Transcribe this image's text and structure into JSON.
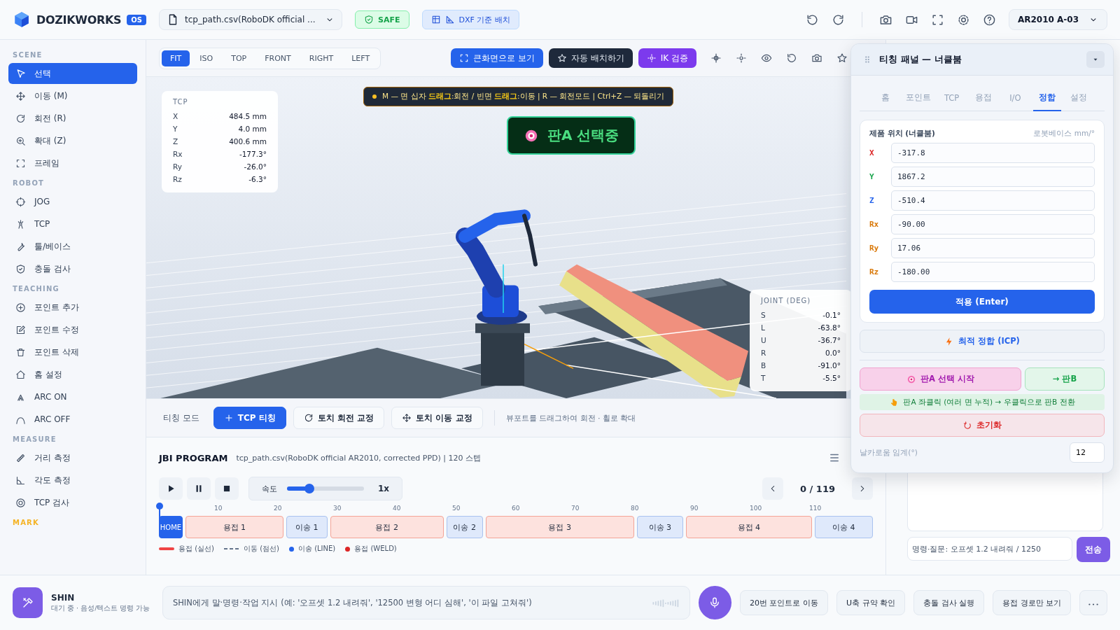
{
  "topbar": {
    "brand": "DOZIKWORKS",
    "badge": "OS",
    "file": "tcp_path.csv(RoboDK official ...",
    "safety": "SAFE",
    "layout_button": "DXF 기준 배치",
    "robot": "AR2010 A-03"
  },
  "sidebar": {
    "sections": [
      {
        "title": "SCENE",
        "color": "#94a3b8",
        "items": [
          {
            "label": "선택",
            "selected": true
          },
          {
            "label": "이동 (M)",
            "selected": false
          },
          {
            "label": "회전 (R)",
            "selected": false
          },
          {
            "label": "확대 (Z)",
            "selected": false
          },
          {
            "label": "프레임",
            "selected": false
          }
        ]
      },
      {
        "title": "ROBOT",
        "color": "#94a3b8",
        "items": [
          {
            "label": "JOG",
            "selected": false
          },
          {
            "label": "TCP",
            "selected": false
          },
          {
            "label": "툴/베이스",
            "selected": false
          },
          {
            "label": "충돌 검사",
            "selected": false
          }
        ]
      },
      {
        "title": "TEACHING",
        "color": "#94a3b8",
        "items": [
          {
            "label": "포인트 추가",
            "selected": false
          },
          {
            "label": "포인트 수정",
            "selected": false
          },
          {
            "label": "포인트 삭제",
            "selected": false
          },
          {
            "label": "홈 설정",
            "selected": false
          },
          {
            "label": "ARC ON",
            "selected": false
          },
          {
            "label": "ARC OFF",
            "selected": false
          }
        ]
      },
      {
        "title": "MEASURE",
        "color": "#94a3b8",
        "items": [
          {
            "label": "거리 측정",
            "selected": false
          },
          {
            "label": "각도 측정",
            "selected": false
          },
          {
            "label": "TCP 검사",
            "selected": false
          }
        ]
      },
      {
        "title": "MARK",
        "color": "#f5b324"
      }
    ]
  },
  "viewport": {
    "views": [
      {
        "label": "FIT",
        "selected": true
      },
      {
        "label": "ISO",
        "selected": false
      },
      {
        "label": "TOP",
        "selected": false
      },
      {
        "label": "FRONT",
        "selected": false
      },
      {
        "label": "RIGHT",
        "selected": false
      },
      {
        "label": "LEFT",
        "selected": false
      }
    ],
    "actions": [
      {
        "label": "큰화면으로 보기",
        "kind": "primary"
      },
      {
        "label": "자동 배치하기",
        "kind": "dark"
      },
      {
        "label": "IK 검증",
        "kind": "accent"
      }
    ],
    "hint": "M — 면 십자 **드래그**:회전 / 빈면 **드래그**:이동 | R — 회전모드 | Ctrl+Z — 되돌리기",
    "toast": "판A 선택중",
    "tcp": {
      "title": "TCP",
      "rows": [
        {
          "axis": "X",
          "value": "484.5 mm"
        },
        {
          "axis": "Y",
          "value": "4.0 mm"
        },
        {
          "axis": "Z",
          "value": "400.6 mm"
        },
        {
          "axis": "Rx",
          "value": "-177.3°"
        },
        {
          "axis": "Ry",
          "value": "-26.0°"
        },
        {
          "axis": "Rz",
          "value": "-6.3°"
        }
      ]
    },
    "joints": {
      "title": "JOINT (DEG)",
      "rows": [
        {
          "axis": "S",
          "value": "-0.1°"
        },
        {
          "axis": "L",
          "value": "-63.8°"
        },
        {
          "axis": "U",
          "value": "-36.7°"
        },
        {
          "axis": "R",
          "value": "0.0°"
        },
        {
          "axis": "B",
          "value": "-91.0°"
        },
        {
          "axis": "T",
          "value": "-5.5°"
        }
      ]
    }
  },
  "teach_bar": {
    "label": "티칭 모드",
    "modes": [
      {
        "label": "TCP 티칭",
        "selected": true
      },
      {
        "label": "토치 회전 교정",
        "selected": false
      },
      {
        "label": "토치 이동 교정",
        "selected": false
      }
    ],
    "hint": "뷰포트를 드래그하여 회전 · 휠로 확대"
  },
  "program": {
    "title": "JBI PROGRAM",
    "subtitle": "tcp_path.csv(RoboDK official AR2010, corrected PPD) | 120 스텝",
    "speed_label": "속도",
    "speed": {
      "level": 0.25
    },
    "speed_reading": "1x",
    "position": "0 / 119",
    "ticks": [
      "10",
      "20",
      "30",
      "40",
      "50",
      "60",
      "70",
      "80",
      "90",
      "100",
      "110"
    ],
    "segments": [
      {
        "label": "HOME",
        "kind": "home"
      },
      {
        "label": "용접 1",
        "kind": "weld"
      },
      {
        "label": "이송 1",
        "kind": "move"
      },
      {
        "label": "용접 2",
        "kind": "weld"
      },
      {
        "label": "이송 2",
        "kind": "move"
      },
      {
        "label": "용접 3",
        "kind": "weld"
      },
      {
        "label": "이송 3",
        "kind": "move"
      },
      {
        "label": "용접 4",
        "kind": "weld"
      },
      {
        "label": "이송 4",
        "kind": "move"
      }
    ],
    "legend": [
      {
        "label": "용접 (실선)",
        "kind": "line",
        "color": "#ef4444"
      },
      {
        "label": "이동 (점선)",
        "kind": "dashed",
        "color": "#64748b"
      },
      {
        "label": "이송 (LINE)",
        "kind": "dot",
        "color": "#2563eb"
      },
      {
        "label": "용접 (WELD)",
        "kind": "dot",
        "color": "#dc2626"
      }
    ]
  },
  "panel": {
    "title": "티칭 패널 — 너클붐",
    "tabs": [
      {
        "label": "홈",
        "selected": false
      },
      {
        "label": "포인트",
        "selected": false
      },
      {
        "label": "TCP",
        "selected": false
      },
      {
        "label": "용접",
        "selected": false
      },
      {
        "label": "I/O",
        "selected": false
      },
      {
        "label": "정합",
        "selected": true
      },
      {
        "label": "설정",
        "selected": false
      }
    ],
    "card_title": "제품 위치 (너클붐)",
    "card_unit": "로봇베이스 mm/°",
    "fields": [
      {
        "label": "X",
        "value": "-317.8",
        "color": "#dc2626"
      },
      {
        "label": "Y",
        "value": "1867.2",
        "color": "#16a34a"
      },
      {
        "label": "Z",
        "value": "-510.4",
        "color": "#2563eb"
      },
      {
        "label": "Rx",
        "value": "-90.00",
        "color": "#d97706"
      },
      {
        "label": "Ry",
        "value": "17.06",
        "color": "#d97706"
      },
      {
        "label": "Rz",
        "value": "-180.00",
        "color": "#d97706"
      }
    ],
    "apply": "적용 (Enter)",
    "icp": "최적 정합 (ICP)",
    "select_a": "판A 선택 시작",
    "to_b": "→ 판B",
    "info": "판A 좌클릭 (여러 면 누적) → 우클릭으로 판B 전환",
    "reset": "초기화",
    "threshold_label": "날카로움 임계(°)",
    "threshold": "12"
  },
  "chat": {
    "placeholder": "명령·질문: 오프셋 1.2 내려줘 / 1250",
    "send": "전송"
  },
  "assistant": {
    "name": "SHIN",
    "status": "대기 중 · 음성/텍스트 명령 가능",
    "placeholder": "SHIN에게 말·명령·작업 지시 (예: '오프셋 1.2 내려줘', '12500 변형 어디 심해', '이 파일 고쳐줘')",
    "quick": [
      "20번 포인트로 이동",
      "U축 규약 확인",
      "충돌 검사 실행",
      "용접 경로만 보기"
    ]
  }
}
